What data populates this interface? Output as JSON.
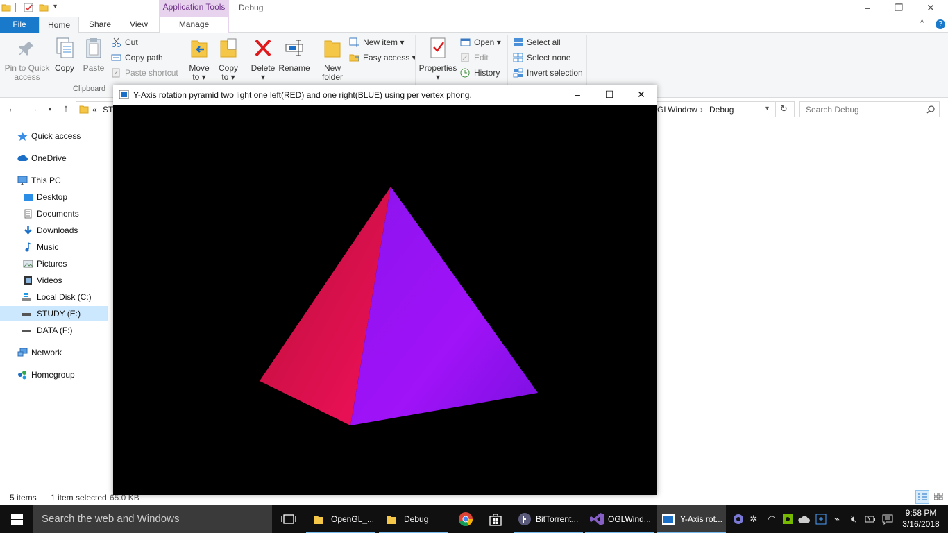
{
  "explorer": {
    "context_tab_group": "Application Tools",
    "window_title": "Debug",
    "tabs": {
      "file": "File",
      "home": "Home",
      "share": "Share",
      "view": "View",
      "manage": "Manage"
    },
    "ribbon": {
      "pin_quick_access": "Pin to Quick access",
      "copy": "Copy",
      "paste": "Paste",
      "cut": "Cut",
      "copy_path": "Copy path",
      "paste_shortcut": "Paste shortcut",
      "clipboard_group": "Clipboard",
      "move_to": "Move to",
      "copy_to": "Copy to",
      "delete": "Delete",
      "rename": "Rename",
      "new_folder": "New folder",
      "new_item": "New item",
      "easy_access": "Easy access",
      "properties": "Properties",
      "open": "Open",
      "edit": "Edit",
      "history": "History",
      "select_all": "Select all",
      "select_none": "Select none",
      "invert_selection": "Invert selection"
    },
    "address": {
      "chevron": "«",
      "left_crumb": "ST",
      "crumb_partial": "GLWindow",
      "crumb_sep": "›",
      "crumb_current": "Debug",
      "search_placeholder": "Search Debug"
    },
    "nav": {
      "quick_access": "Quick access",
      "onedrive": "OneDrive",
      "this_pc": "This PC",
      "desktop": "Desktop",
      "documents": "Documents",
      "downloads": "Downloads",
      "music": "Music",
      "pictures": "Pictures",
      "videos": "Videos",
      "local_disk": "Local Disk (C:)",
      "study": "STUDY (E:)",
      "data": "DATA (F:)",
      "network": "Network",
      "homegroup": "Homegroup"
    },
    "status": {
      "items": "5 items",
      "selected": "1 item selected",
      "size": "65.0 KB"
    }
  },
  "gl_window": {
    "title": "Y-Axis rotation pyramid two light one left(RED) and one right(BLUE) using per vertex phong."
  },
  "taskbar": {
    "search_placeholder": "Search the web and Windows",
    "apps": {
      "opengl": "OpenGL_...",
      "debug": "Debug",
      "bittorrent": "BitTorrent...",
      "oglwindow": "OGLWind...",
      "yaxis": "Y-Axis rot..."
    },
    "time": "9:58 PM",
    "date": "3/16/2018"
  },
  "colors": {
    "accent": "#1979ca",
    "context_tab": "#e8d3ef",
    "selection": "#cce8ff",
    "pyramid_left_face": "#d4104e",
    "pyramid_right_face": "#9a10f0"
  }
}
